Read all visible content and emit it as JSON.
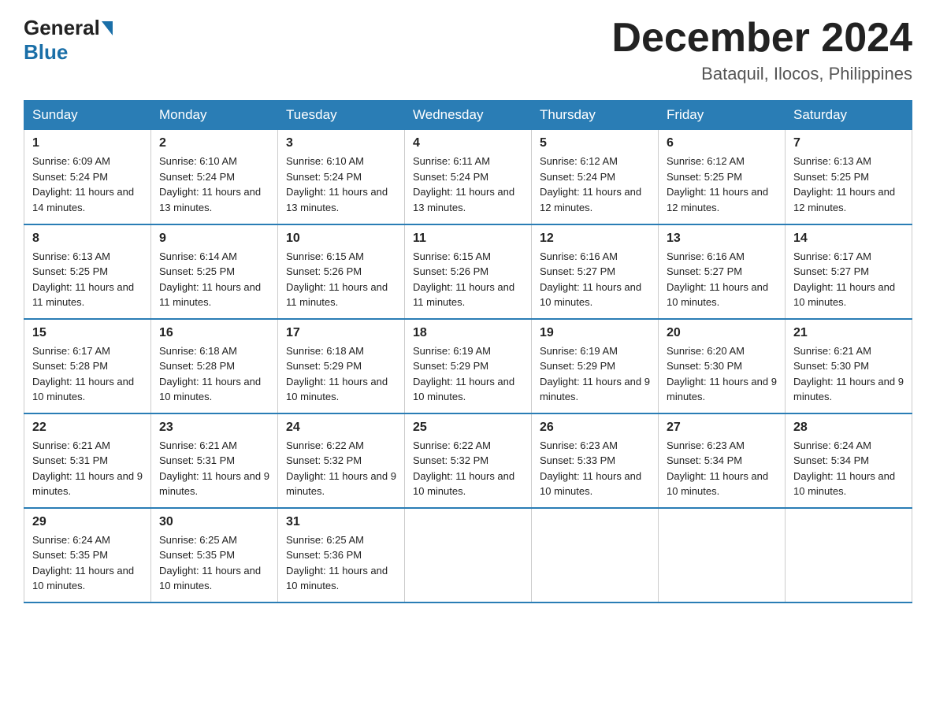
{
  "header": {
    "logo_general": "General",
    "logo_blue": "Blue",
    "month_year": "December 2024",
    "location": "Bataquil, Ilocos, Philippines"
  },
  "days_of_week": [
    "Sunday",
    "Monday",
    "Tuesday",
    "Wednesday",
    "Thursday",
    "Friday",
    "Saturday"
  ],
  "weeks": [
    [
      {
        "day": "1",
        "sunrise": "6:09 AM",
        "sunset": "5:24 PM",
        "daylight": "11 hours and 14 minutes."
      },
      {
        "day": "2",
        "sunrise": "6:10 AM",
        "sunset": "5:24 PM",
        "daylight": "11 hours and 13 minutes."
      },
      {
        "day": "3",
        "sunrise": "6:10 AM",
        "sunset": "5:24 PM",
        "daylight": "11 hours and 13 minutes."
      },
      {
        "day": "4",
        "sunrise": "6:11 AM",
        "sunset": "5:24 PM",
        "daylight": "11 hours and 13 minutes."
      },
      {
        "day": "5",
        "sunrise": "6:12 AM",
        "sunset": "5:24 PM",
        "daylight": "11 hours and 12 minutes."
      },
      {
        "day": "6",
        "sunrise": "6:12 AM",
        "sunset": "5:25 PM",
        "daylight": "11 hours and 12 minutes."
      },
      {
        "day": "7",
        "sunrise": "6:13 AM",
        "sunset": "5:25 PM",
        "daylight": "11 hours and 12 minutes."
      }
    ],
    [
      {
        "day": "8",
        "sunrise": "6:13 AM",
        "sunset": "5:25 PM",
        "daylight": "11 hours and 11 minutes."
      },
      {
        "day": "9",
        "sunrise": "6:14 AM",
        "sunset": "5:25 PM",
        "daylight": "11 hours and 11 minutes."
      },
      {
        "day": "10",
        "sunrise": "6:15 AM",
        "sunset": "5:26 PM",
        "daylight": "11 hours and 11 minutes."
      },
      {
        "day": "11",
        "sunrise": "6:15 AM",
        "sunset": "5:26 PM",
        "daylight": "11 hours and 11 minutes."
      },
      {
        "day": "12",
        "sunrise": "6:16 AM",
        "sunset": "5:27 PM",
        "daylight": "11 hours and 10 minutes."
      },
      {
        "day": "13",
        "sunrise": "6:16 AM",
        "sunset": "5:27 PM",
        "daylight": "11 hours and 10 minutes."
      },
      {
        "day": "14",
        "sunrise": "6:17 AM",
        "sunset": "5:27 PM",
        "daylight": "11 hours and 10 minutes."
      }
    ],
    [
      {
        "day": "15",
        "sunrise": "6:17 AM",
        "sunset": "5:28 PM",
        "daylight": "11 hours and 10 minutes."
      },
      {
        "day": "16",
        "sunrise": "6:18 AM",
        "sunset": "5:28 PM",
        "daylight": "11 hours and 10 minutes."
      },
      {
        "day": "17",
        "sunrise": "6:18 AM",
        "sunset": "5:29 PM",
        "daylight": "11 hours and 10 minutes."
      },
      {
        "day": "18",
        "sunrise": "6:19 AM",
        "sunset": "5:29 PM",
        "daylight": "11 hours and 10 minutes."
      },
      {
        "day": "19",
        "sunrise": "6:19 AM",
        "sunset": "5:29 PM",
        "daylight": "11 hours and 9 minutes."
      },
      {
        "day": "20",
        "sunrise": "6:20 AM",
        "sunset": "5:30 PM",
        "daylight": "11 hours and 9 minutes."
      },
      {
        "day": "21",
        "sunrise": "6:21 AM",
        "sunset": "5:30 PM",
        "daylight": "11 hours and 9 minutes."
      }
    ],
    [
      {
        "day": "22",
        "sunrise": "6:21 AM",
        "sunset": "5:31 PM",
        "daylight": "11 hours and 9 minutes."
      },
      {
        "day": "23",
        "sunrise": "6:21 AM",
        "sunset": "5:31 PM",
        "daylight": "11 hours and 9 minutes."
      },
      {
        "day": "24",
        "sunrise": "6:22 AM",
        "sunset": "5:32 PM",
        "daylight": "11 hours and 9 minutes."
      },
      {
        "day": "25",
        "sunrise": "6:22 AM",
        "sunset": "5:32 PM",
        "daylight": "11 hours and 10 minutes."
      },
      {
        "day": "26",
        "sunrise": "6:23 AM",
        "sunset": "5:33 PM",
        "daylight": "11 hours and 10 minutes."
      },
      {
        "day": "27",
        "sunrise": "6:23 AM",
        "sunset": "5:34 PM",
        "daylight": "11 hours and 10 minutes."
      },
      {
        "day": "28",
        "sunrise": "6:24 AM",
        "sunset": "5:34 PM",
        "daylight": "11 hours and 10 minutes."
      }
    ],
    [
      {
        "day": "29",
        "sunrise": "6:24 AM",
        "sunset": "5:35 PM",
        "daylight": "11 hours and 10 minutes."
      },
      {
        "day": "30",
        "sunrise": "6:25 AM",
        "sunset": "5:35 PM",
        "daylight": "11 hours and 10 minutes."
      },
      {
        "day": "31",
        "sunrise": "6:25 AM",
        "sunset": "5:36 PM",
        "daylight": "11 hours and 10 minutes."
      },
      null,
      null,
      null,
      null
    ]
  ]
}
